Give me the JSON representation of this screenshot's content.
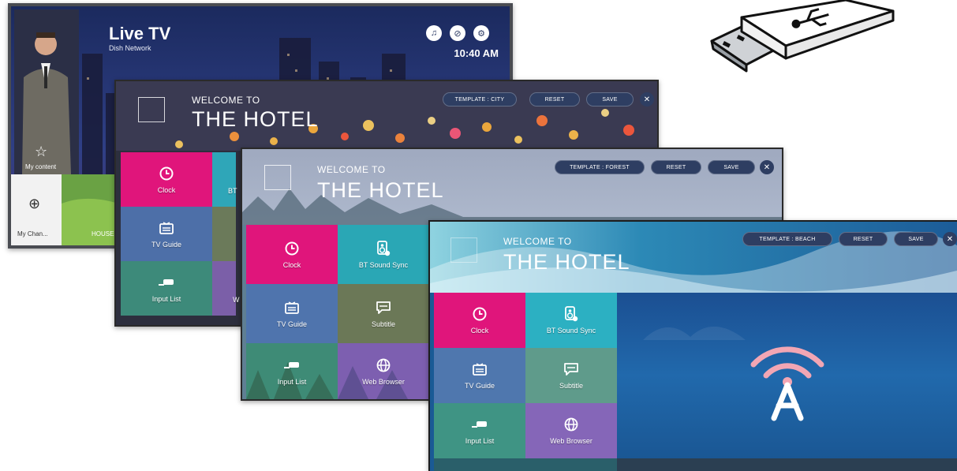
{
  "live_tv": {
    "title": "Live TV",
    "subtitle": "Dish Network",
    "time": "10:40 AM",
    "my_content_label": "My content",
    "my_channel_label": "My Chan...",
    "thumbnail_label": "HOUSE T..."
  },
  "hotel_city": {
    "welcome": "WELCOME TO",
    "title": "THE HOTEL",
    "template_label": "TEMPLATE : CITY",
    "reset_label": "RESET",
    "save_label": "SAVE",
    "close_label": "✕",
    "tiles": [
      "Clock",
      "BT",
      "TV Guide",
      "Input List",
      "W"
    ]
  },
  "hotel_forest": {
    "welcome": "WELCOME TO",
    "title": "THE HOTEL",
    "template_label": "TEMPLATE : FOREST",
    "reset_label": "RESET",
    "save_label": "SAVE",
    "close_label": "✕",
    "tiles": [
      "Clock",
      "BT Sound Sync",
      "TV Guide",
      "Subtitle",
      "Input List",
      "Web Browser"
    ]
  },
  "hotel_beach": {
    "welcome": "WELCOME TO",
    "title": "THE HOTEL",
    "template_label": "TEMPLATE : BEACH",
    "reset_label": "RESET",
    "save_label": "SAVE",
    "close_label": "✕",
    "tiles": [
      "Clock",
      "BT Sound Sync",
      "TV Guide",
      "Subtitle",
      "Input List",
      "Web Browser"
    ]
  },
  "colors": {
    "clock_tile": "#e0157b",
    "pill_bg": "#2e3e62",
    "beach_panel": "#1f64a8",
    "wifi_pink": "#f2a6b4"
  }
}
